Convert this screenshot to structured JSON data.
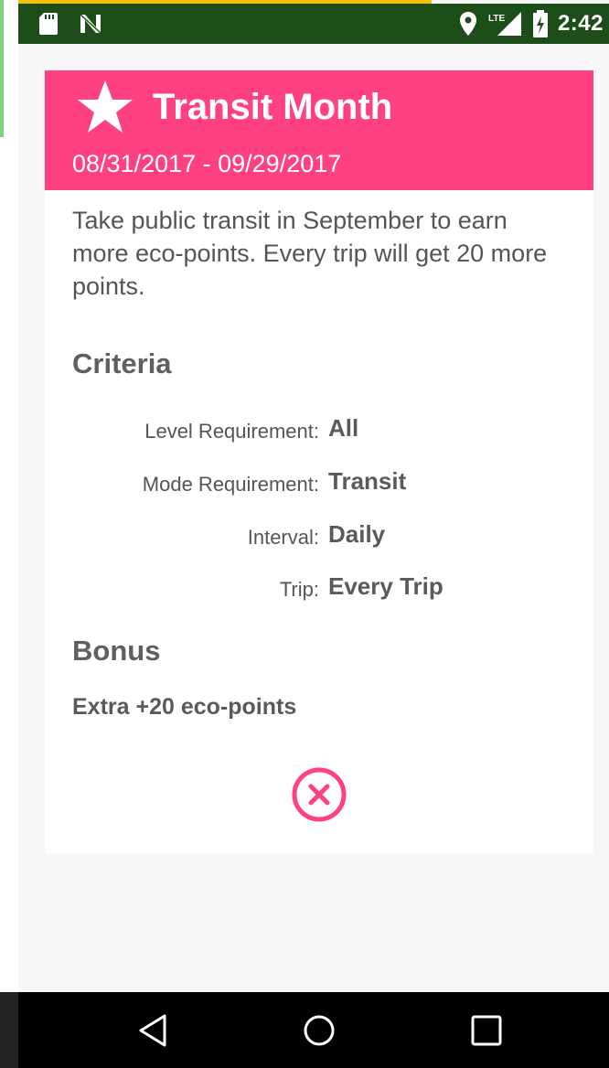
{
  "status_bar": {
    "time": "2:42",
    "icons": [
      "sd-card-icon",
      "n-notification-icon",
      "location-icon",
      "lte-signal-icon",
      "battery-charging-icon"
    ],
    "lte_label": "LTE"
  },
  "dialog": {
    "title": "Transit Month",
    "dates": "08/31/2017 - 09/29/2017",
    "description": "Take public transit in September to earn more eco-points. Every trip will get 20 more points.",
    "criteria_heading": "Criteria",
    "criteria": [
      {
        "label": "Level Requirement:",
        "value": "All"
      },
      {
        "label": "Mode Requirement:",
        "value": "Transit"
      },
      {
        "label": "Interval:",
        "value": "Daily"
      },
      {
        "label": "Trip:",
        "value": "Every Trip"
      }
    ],
    "bonus_heading": "Bonus",
    "bonus_text": "Extra +20 eco-points",
    "close_icon": "close-circle-icon"
  },
  "colors": {
    "header": "#ff4081",
    "status_bar": "#1d4d18",
    "text": "#555555"
  },
  "nav_bar": {
    "icons": [
      "back-icon",
      "home-icon",
      "recents-icon"
    ]
  }
}
